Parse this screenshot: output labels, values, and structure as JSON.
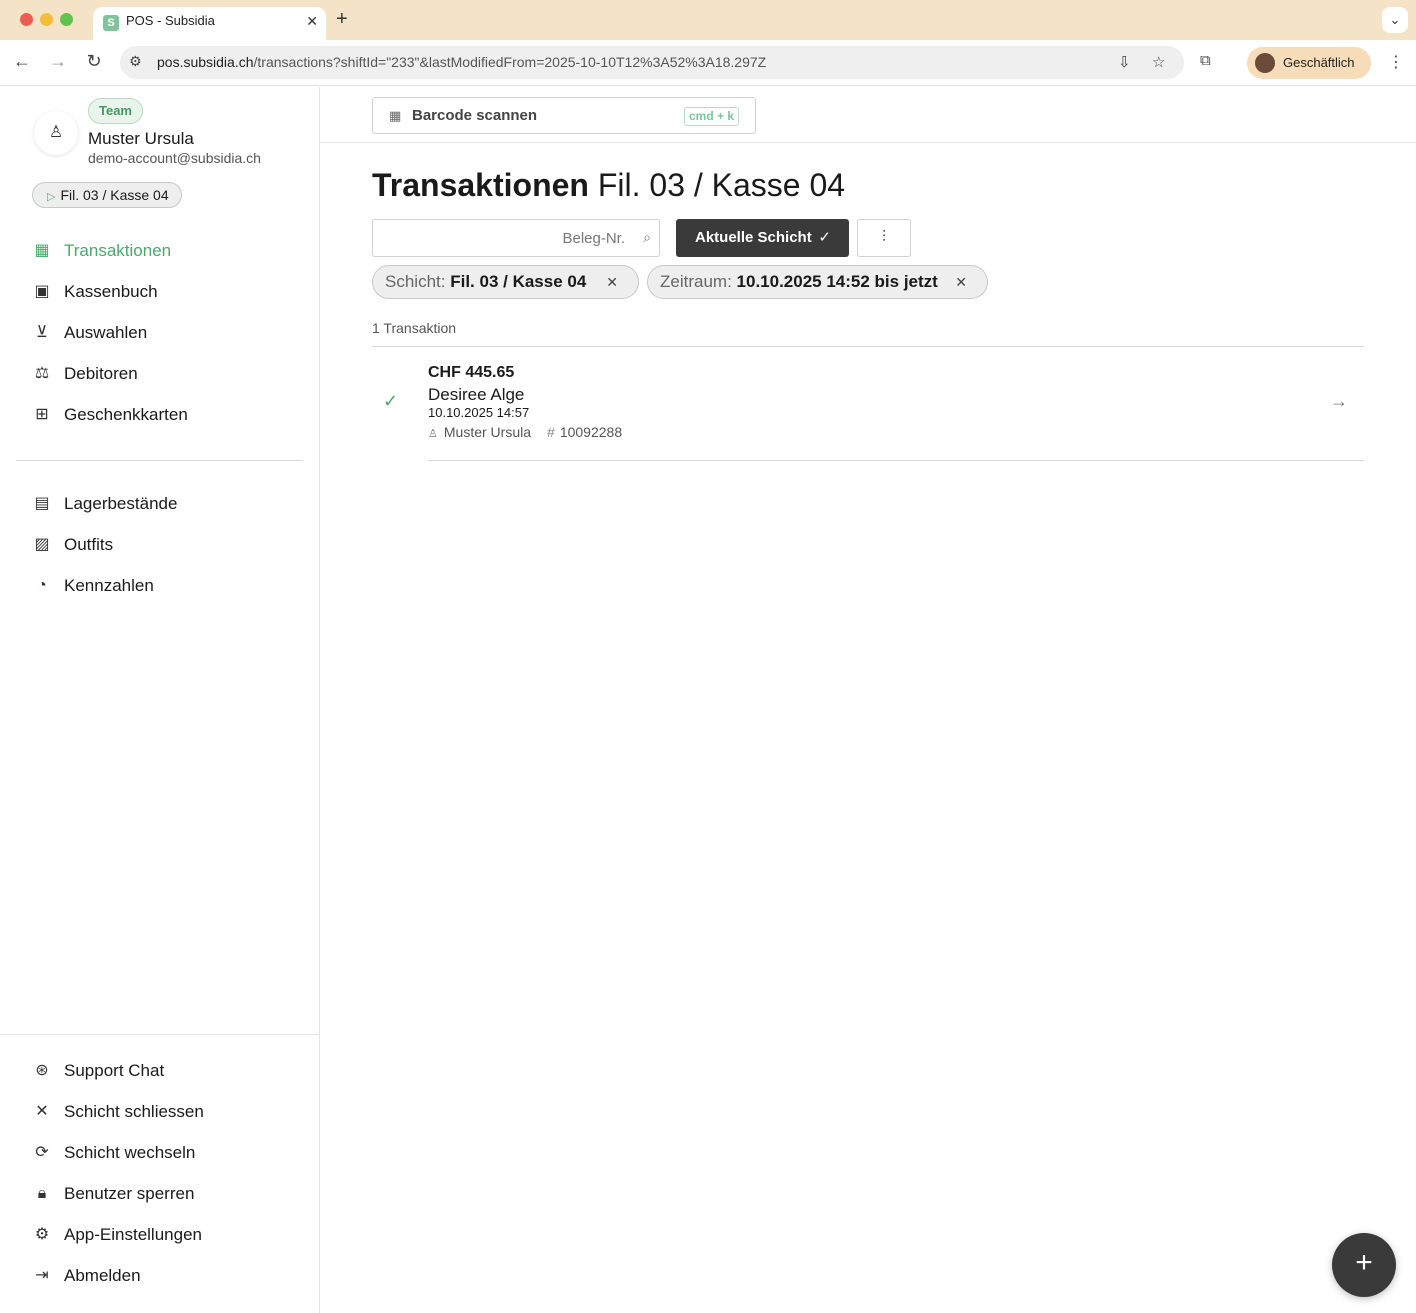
{
  "browser": {
    "tab_title": "POS - Subsidia",
    "tab_favicon": "S",
    "url_host": "pos.subsidia.ch",
    "url_path": "/transactions?shiftId=\"233\"&lastModifiedFrom=2025-10-10T12%3A52%3A18.297Z",
    "profile_label": "Geschäftlich"
  },
  "user": {
    "team_badge": "Team",
    "name": "Muster Ursula",
    "email": "demo-account@subsidia.ch",
    "shift_pill": "Fil. 03 / Kasse 04"
  },
  "nav_main": [
    {
      "label": "Transaktionen",
      "icon": "qr-grid-icon",
      "active": true
    },
    {
      "label": "Kassenbuch",
      "icon": "cash-icon"
    },
    {
      "label": "Auswahlen",
      "icon": "cart-icon"
    },
    {
      "label": "Debitoren",
      "icon": "scale-icon"
    },
    {
      "label": "Geschenkkarten",
      "icon": "gift-icon"
    }
  ],
  "nav_secondary": [
    {
      "label": "Lagerbestände",
      "icon": "clipboard-icon"
    },
    {
      "label": "Outfits",
      "icon": "image-icon"
    },
    {
      "label": "Kennzahlen",
      "icon": "pie-chart-icon"
    }
  ],
  "nav_bottom": [
    {
      "label": "Support Chat",
      "icon": "lifebuoy-icon"
    },
    {
      "label": "Schicht schliessen",
      "icon": "close-icon"
    },
    {
      "label": "Schicht wechseln",
      "icon": "refresh-icon"
    },
    {
      "label": "Benutzer sperren",
      "icon": "lock-icon"
    },
    {
      "label": "App-Einstellungen",
      "icon": "gear-icon"
    },
    {
      "label": "Abmelden",
      "icon": "logout-icon"
    }
  ],
  "topbar": {
    "barcode_label": "Barcode scannen",
    "shortcut": "cmd + k"
  },
  "page": {
    "title_strong": "Transaktionen",
    "title_light": "Fil. 03 / Kasse 04",
    "search_placeholder": "Beleg-Nr.",
    "current_shift_label": "Aktuelle Schicht",
    "chips": {
      "shift_key": "Schicht:",
      "shift_value": "Fil. 03 / Kasse 04",
      "period_key": "Zeitraum:",
      "period_value": "10.10.2025 14:52 bis jetzt"
    },
    "count": "1 Transaktion"
  },
  "transactions": [
    {
      "amount": "CHF 445.65",
      "customer": "Desiree Alge",
      "datetime": "10.10.2025 14:57",
      "cashier": "Muster Ursula",
      "receipt": "10092288"
    }
  ],
  "colors": {
    "accent": "#4aa86c",
    "dark_button": "#3a3a3a",
    "tabbar": "#f5e3c7"
  }
}
